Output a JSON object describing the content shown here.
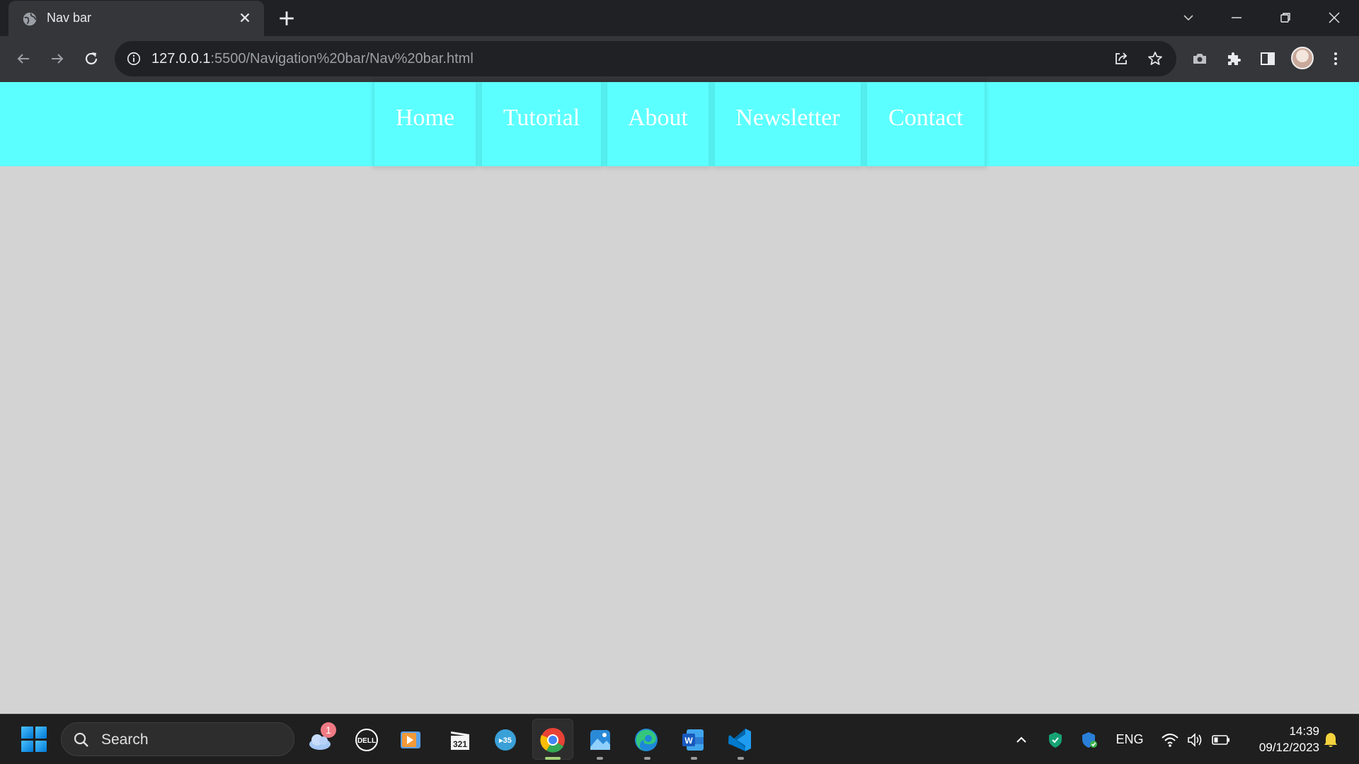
{
  "browser": {
    "tab_title": "Nav bar",
    "url_host": "127.0.0.1",
    "url_rest": ":5500/Navigation%20bar/Nav%20bar.html"
  },
  "navbar": {
    "items": [
      {
        "label": "Home"
      },
      {
        "label": "Tutorial"
      },
      {
        "label": "About"
      },
      {
        "label": "Newsletter"
      },
      {
        "label": "Contact"
      }
    ],
    "background": "#5cffff",
    "text_color": "#ffffff"
  },
  "page": {
    "background": "#d3d3d3"
  },
  "taskbar": {
    "search_label": "Search",
    "weather_badge": "1",
    "language": "ENG",
    "time": "14:39",
    "date": "09/12/2023",
    "apps": [
      "weather-app",
      "dell-app",
      "media-player-app",
      "video-editor-app",
      "hp-app",
      "chrome-app",
      "photos-app",
      "edge-app",
      "word-app",
      "vscode-app"
    ]
  }
}
